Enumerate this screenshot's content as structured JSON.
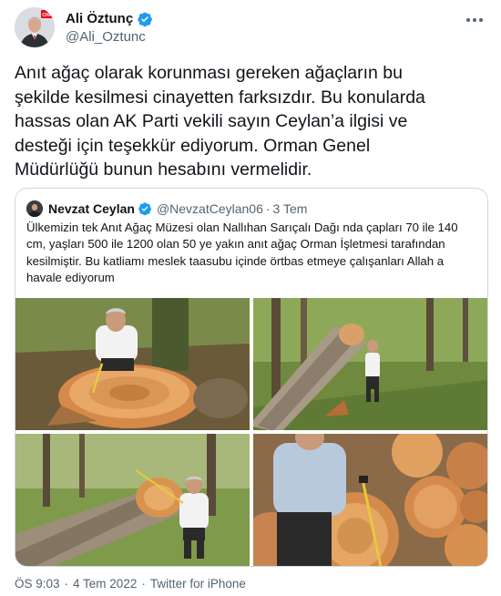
{
  "author": {
    "name": "Ali Öztunç",
    "handle": "@Ali_Oztunc",
    "avatar_badge": "CHP",
    "verified_color": "#1d9bf0"
  },
  "tweet": {
    "text": "Anıt ağaç olarak korunması gereken ağaçların bu\nşekilde kesilmesi cinayetten farksızdır. Bu konularda\nhassas olan AK Parti vekili sayın Ceylan’a ilgisi ve\ndesteği için teşekkür ediyorum. Orman Genel\nMüdürlüğü bunun hesabını vermelidir."
  },
  "quoted": {
    "name": "Nevzat Ceylan",
    "handle": "@NevzatCeylan06",
    "separator": "·",
    "time": "3 Tem",
    "text": "Ülkemizin tek Anıt Ağaç Müzesi olan Nallıhan Sarıçalı Dağı nda çapları 70 ile 140 cm, yaşları 500 ile 1200 olan 50 ye yakın anıt ağaç Orman İşletmesi tarafından kesilmiştir. Bu katliamı meslek taasubu içinde örtbas etmeye çalışanları Allah a havale ediyorum",
    "photos": [
      {
        "name": "photo-man-measuring-stump"
      },
      {
        "name": "photo-fallen-trunk-forest"
      },
      {
        "name": "photo-man-at-cut-log"
      },
      {
        "name": "photo-log-pile-measuring"
      }
    ]
  },
  "footer": {
    "time": "ÖS 9:03",
    "separator": "·",
    "date": "4 Tem 2022",
    "source": "Twitter for iPhone"
  },
  "colors": {
    "text": "#0f1419",
    "secondary": "#536471",
    "border": "#cfd9de",
    "verified": "#1d9bf0"
  }
}
